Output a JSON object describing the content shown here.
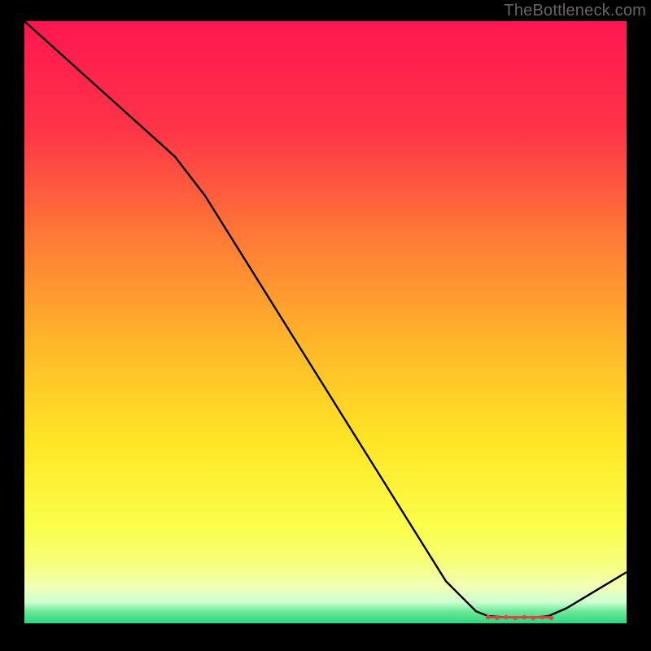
{
  "attribution": "TheBottleneck.com",
  "chart_data": {
    "type": "line",
    "title": "",
    "xlabel": "",
    "ylabel": "",
    "xlim": [
      0,
      100
    ],
    "ylim": [
      0,
      100
    ],
    "x": [
      0,
      5,
      10,
      15,
      20,
      25,
      30,
      35,
      40,
      45,
      50,
      55,
      60,
      65,
      70,
      75,
      77,
      80,
      83,
      85,
      87,
      90,
      95,
      100
    ],
    "y": [
      100,
      95.5,
      91,
      86.5,
      82,
      77.5,
      71,
      63,
      55,
      47,
      39,
      31,
      23,
      15,
      7,
      2,
      1.2,
      1.0,
      1.0,
      1.0,
      1.2,
      2.5,
      5.5,
      8.5
    ],
    "trough_markers_x": [
      77,
      78.5,
      80,
      81.5,
      83,
      84.5,
      86,
      87.5
    ],
    "gradient_stops": [
      {
        "offset": 0,
        "color": "#ff1750"
      },
      {
        "offset": 18,
        "color": "#ff3448"
      },
      {
        "offset": 36,
        "color": "#ff7a36"
      },
      {
        "offset": 54,
        "color": "#ffb829"
      },
      {
        "offset": 70,
        "color": "#ffe625"
      },
      {
        "offset": 84,
        "color": "#faff4a"
      },
      {
        "offset": 90,
        "color": "#f6ff7a"
      },
      {
        "offset": 94,
        "color": "#f2ffb8"
      },
      {
        "offset": 96.5,
        "color": "#ccffd0"
      },
      {
        "offset": 98,
        "color": "#6fe89a"
      },
      {
        "offset": 100,
        "color": "#2bd87a"
      }
    ]
  }
}
